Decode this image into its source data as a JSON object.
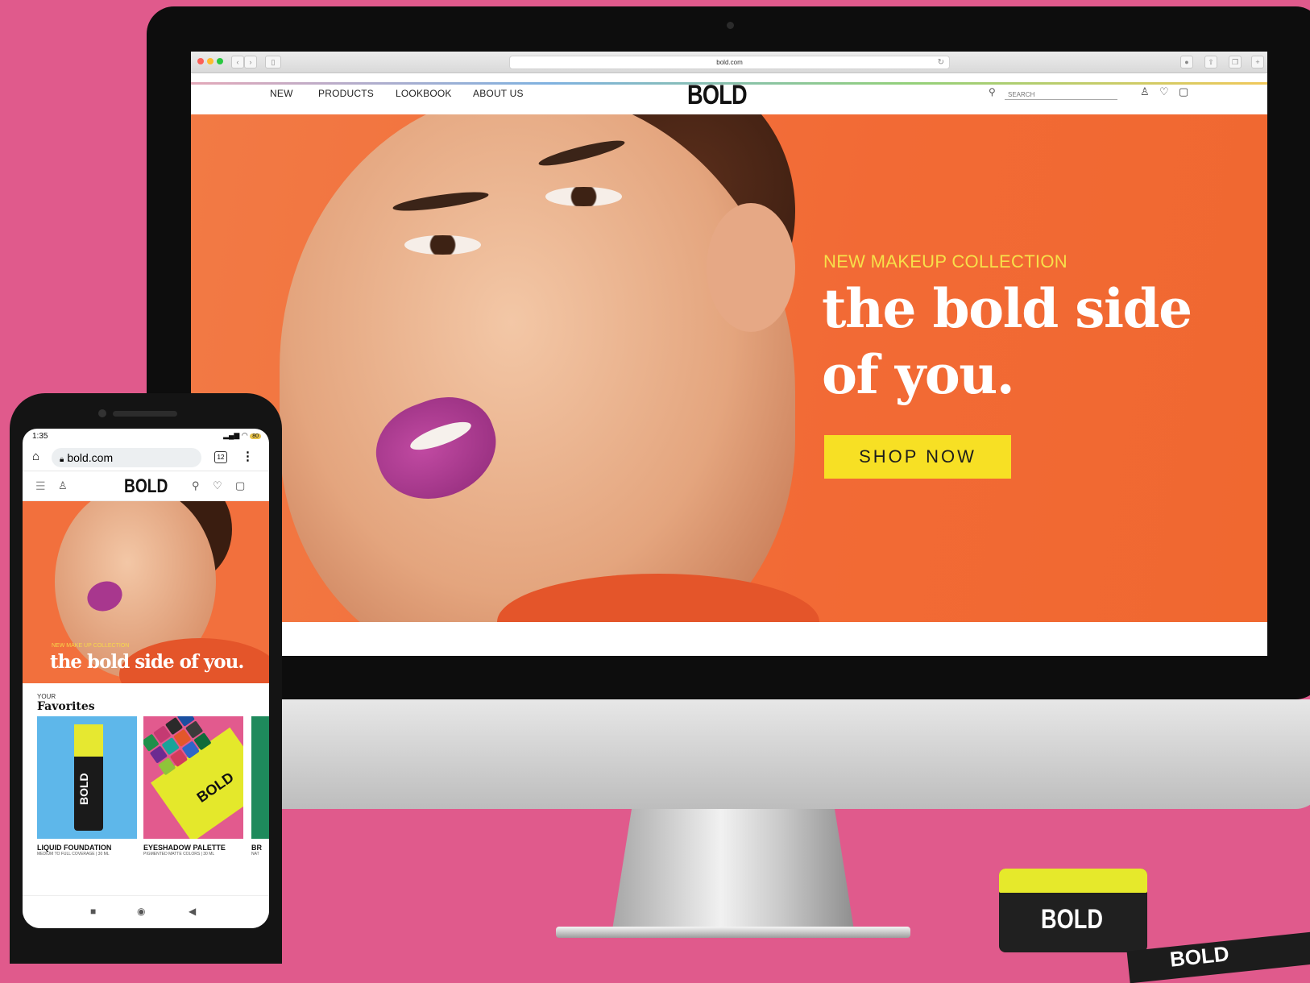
{
  "desktop": {
    "browser": {
      "url": "bold.com"
    },
    "site": {
      "nav_links": [
        "NEW",
        "PRODUCTS",
        "LOOKBOOK",
        "ABOUT US"
      ],
      "brand": "BOLD",
      "search_placeholder": "SEARCH",
      "icons": [
        "user-icon",
        "heart-icon",
        "bag-icon"
      ]
    },
    "hero": {
      "kicker": "NEW MAKEUP COLLECTION",
      "title": "the bold side of you.",
      "cta": "SHOP NOW"
    }
  },
  "mobile": {
    "status": {
      "time": "1:35",
      "battery": "80"
    },
    "url": "bold.com",
    "tab_count": "12",
    "brand": "BOLD",
    "hero": {
      "kicker": "NEW MAKE UP COLLECTION",
      "title": "the bold side of you."
    },
    "favorites": {
      "kicker": "YOUR",
      "title": "Favorites",
      "items": [
        {
          "name": "LIQUID FOUNDATION",
          "sub": "MEDIUM TO FULL COVERAGE | 30 ML",
          "label": "BOLD"
        },
        {
          "name": "EYESHADOW PALETTE",
          "sub": "PIGMENTED MATTE COLORS | 30 ML",
          "label": "BOLD"
        },
        {
          "name": "BR",
          "sub": "NAT"
        }
      ]
    }
  },
  "products": {
    "jar_brand": "BOLD",
    "tube_brand": "BOLD"
  },
  "colors": {
    "background": "#e05a8c",
    "hero_orange": "#f26a35",
    "accent_yellow": "#f7e024",
    "lip_magenta": "#a8378e"
  }
}
